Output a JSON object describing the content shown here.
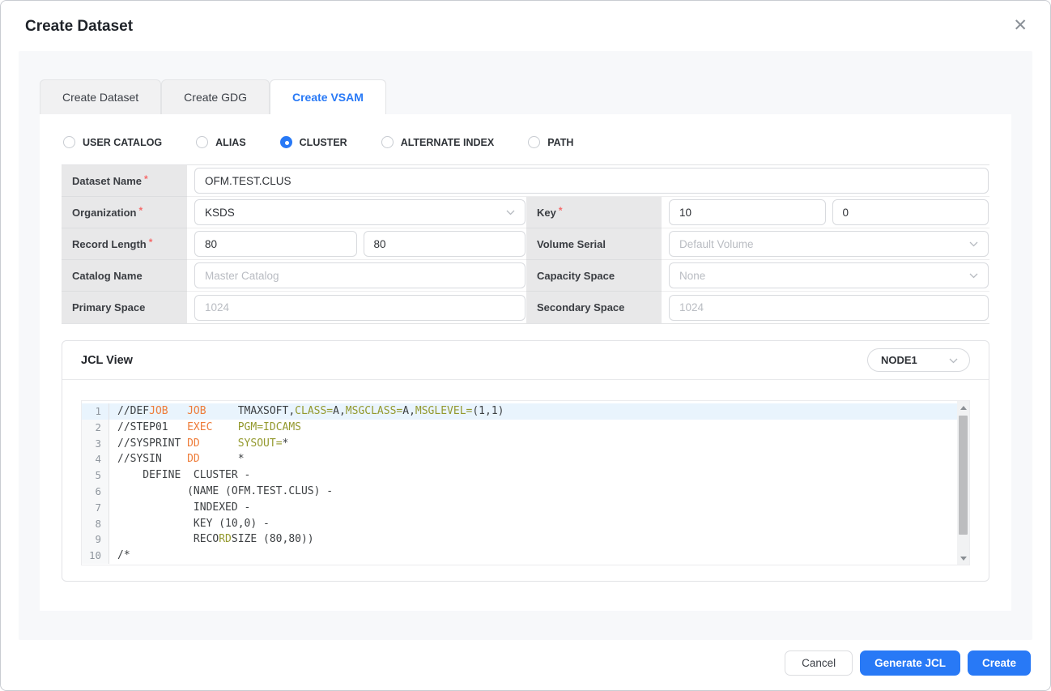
{
  "dialog": {
    "title": "Create Dataset",
    "close_icon": "✕"
  },
  "tabs": [
    {
      "label": "Create Dataset",
      "active": false
    },
    {
      "label": "Create GDG",
      "active": false
    },
    {
      "label": "Create VSAM",
      "active": true
    }
  ],
  "radios": [
    {
      "label": "USER CATALOG",
      "selected": false
    },
    {
      "label": "ALIAS",
      "selected": false
    },
    {
      "label": "CLUSTER",
      "selected": true
    },
    {
      "label": "ALTERNATE INDEX",
      "selected": false
    },
    {
      "label": "PATH",
      "selected": false
    }
  ],
  "form": {
    "dataset_name": {
      "label": "Dataset Name",
      "required": "*",
      "value": "OFM.TEST.CLUS"
    },
    "organization": {
      "label": "Organization",
      "required": "*",
      "value": "KSDS"
    },
    "key": {
      "label": "Key",
      "required": "*",
      "value1": "10",
      "value2": "0"
    },
    "record_length": {
      "label": "Record Length",
      "required": "*",
      "value1": "80",
      "value2": "80"
    },
    "volume_serial": {
      "label": "Volume Serial",
      "placeholder": "Default Volume"
    },
    "catalog_name": {
      "label": "Catalog Name",
      "placeholder": "Master Catalog"
    },
    "capacity_space": {
      "label": "Capacity Space",
      "placeholder": "None"
    },
    "primary_space": {
      "label": "Primary Space",
      "placeholder": "1024"
    },
    "secondary_space": {
      "label": "Secondary Space",
      "placeholder": "1024"
    }
  },
  "jcl": {
    "title": "JCL View",
    "node_select": "NODE1",
    "lines": [
      {
        "num": "1",
        "active": true,
        "tokens": [
          [
            "d",
            "//DEF"
          ],
          [
            "o",
            "JOB"
          ],
          [
            "d",
            "   "
          ],
          [
            "o",
            "JOB"
          ],
          [
            "d",
            "     TMAXSOFT,"
          ],
          [
            "g",
            "CLASS="
          ],
          [
            "d",
            "A,"
          ],
          [
            "g",
            "MSGCLASS="
          ],
          [
            "d",
            "A,"
          ],
          [
            "g",
            "MSGLEVEL="
          ],
          [
            "d",
            "(1,1)"
          ]
        ]
      },
      {
        "num": "2",
        "active": false,
        "tokens": [
          [
            "d",
            "//STEP01"
          ],
          [
            "d",
            "   "
          ],
          [
            "o",
            "EXEC"
          ],
          [
            "d",
            "    "
          ],
          [
            "g",
            "PGM=IDCAMS"
          ]
        ]
      },
      {
        "num": "3",
        "active": false,
        "tokens": [
          [
            "d",
            "//SYSPRINT"
          ],
          [
            "d",
            " "
          ],
          [
            "o",
            "DD"
          ],
          [
            "d",
            "      "
          ],
          [
            "g",
            "SYSOUT="
          ],
          [
            "d",
            "*"
          ]
        ]
      },
      {
        "num": "4",
        "active": false,
        "tokens": [
          [
            "d",
            "//SYSIN"
          ],
          [
            "d",
            "    "
          ],
          [
            "o",
            "DD"
          ],
          [
            "d",
            "      *"
          ]
        ]
      },
      {
        "num": "5",
        "active": false,
        "tokens": [
          [
            "d",
            "    DEFINE  CLUSTER -"
          ]
        ]
      },
      {
        "num": "6",
        "active": false,
        "tokens": [
          [
            "d",
            "           (NAME (OFM.TEST.CLUS) -"
          ]
        ]
      },
      {
        "num": "7",
        "active": false,
        "tokens": [
          [
            "d",
            "            INDEXED -"
          ]
        ]
      },
      {
        "num": "8",
        "active": false,
        "tokens": [
          [
            "d",
            "            KEY (10,0) -"
          ]
        ]
      },
      {
        "num": "9",
        "active": false,
        "tokens": [
          [
            "d",
            "            RECO"
          ],
          [
            "g",
            "RD"
          ],
          [
            "d",
            "SIZE (80,80))"
          ]
        ]
      },
      {
        "num": "10",
        "active": false,
        "tokens": [
          [
            "d",
            "/*"
          ]
        ]
      }
    ]
  },
  "footer": {
    "cancel": "Cancel",
    "generate_jcl": "Generate JCL",
    "create": "Create"
  },
  "colors": {
    "accent_blue": "#2879f6",
    "code_keyword_orange": "#ee7c39",
    "code_param_olive": "#94992e",
    "code_default_text": "#3d4043",
    "active_line_bg": "#e9f4fd",
    "required_red": "#f56a6a",
    "label_cell_bg": "#e8e8e9",
    "panel_bg": "#f7f8fa"
  }
}
